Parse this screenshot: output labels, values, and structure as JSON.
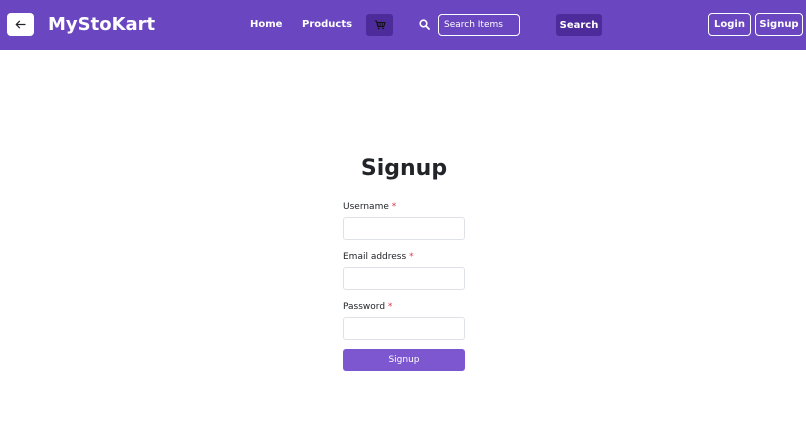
{
  "navbar": {
    "brand": "MyStoKart",
    "back_icon": "arrow-left-icon",
    "links": [
      {
        "label": "Home"
      },
      {
        "label": "Products"
      }
    ],
    "cart_icon": "shopping-cart-icon",
    "search_icon": "search-icon",
    "search": {
      "placeholder": "Search Items",
      "value": ""
    },
    "search_button": "Search",
    "login_button": "Login",
    "signup_button": "Signup",
    "colors": {
      "bar": "#6a46c1",
      "dark_button": "#4e2b9b"
    }
  },
  "form": {
    "title": "Signup",
    "fields": [
      {
        "label": "Username",
        "required_marker": "*",
        "value": ""
      },
      {
        "label": "Email address",
        "required_marker": "*",
        "value": ""
      },
      {
        "label": "Password",
        "required_marker": "*",
        "value": ""
      }
    ],
    "submit_label": "Signup",
    "colors": {
      "submit": "#7d57cf",
      "required": "#dc3545"
    }
  }
}
